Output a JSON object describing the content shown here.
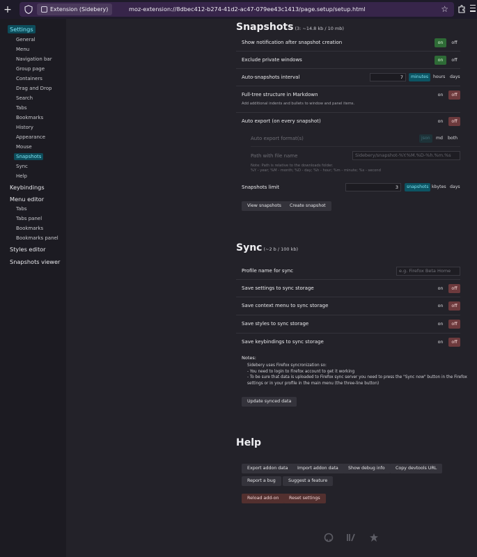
{
  "browser": {
    "extension_chip": "Extension (Sidebery)",
    "url": "moz-extension://8dbec412-b274-41d2-ac47-079ee43c1413/page.setup/setup.html"
  },
  "sidebar": {
    "items": [
      {
        "label": "Settings",
        "level": "top",
        "active": true
      },
      {
        "label": "General",
        "level": "sub"
      },
      {
        "label": "Menu",
        "level": "sub"
      },
      {
        "label": "Navigation bar",
        "level": "sub"
      },
      {
        "label": "Group page",
        "level": "sub"
      },
      {
        "label": "Containers",
        "level": "sub"
      },
      {
        "label": "Drag and Drop",
        "level": "sub"
      },
      {
        "label": "Search",
        "level": "sub"
      },
      {
        "label": "Tabs",
        "level": "sub"
      },
      {
        "label": "Bookmarks",
        "level": "sub"
      },
      {
        "label": "History",
        "level": "sub"
      },
      {
        "label": "Appearance",
        "level": "sub"
      },
      {
        "label": "Mouse",
        "level": "sub"
      },
      {
        "label": "Snapshots",
        "level": "sub",
        "active": true
      },
      {
        "label": "Sync",
        "level": "sub"
      },
      {
        "label": "Help",
        "level": "sub"
      },
      {
        "label": "Keybindings",
        "level": "top"
      },
      {
        "label": "Menu editor",
        "level": "top"
      },
      {
        "label": "Tabs",
        "level": "sub"
      },
      {
        "label": "Tabs panel",
        "level": "sub"
      },
      {
        "label": "Bookmarks",
        "level": "sub"
      },
      {
        "label": "Bookmarks panel",
        "level": "sub"
      },
      {
        "label": "Styles editor",
        "level": "top"
      },
      {
        "label": "Snapshots viewer",
        "level": "top"
      }
    ]
  },
  "snapshots": {
    "title": "Snapshots",
    "size_note": "(3: ~14.8 kb / 10 mb)",
    "show_notification": "Show notification after snapshot creation",
    "exclude_private": "Exclude private windows",
    "auto_interval": "Auto-snapshots interval",
    "auto_interval_value": "7",
    "unit_minutes": "minutes",
    "unit_hours": "hours",
    "unit_days": "days",
    "full_tree": "Full-tree structure in Markdown",
    "full_tree_note": "Add additional indents and bullets to window and panel items.",
    "auto_export": "Auto export (on every snapshot)",
    "export_format": "Auto export format(s)",
    "fmt_json": "json",
    "fmt_md": "md",
    "fmt_both": "both",
    "path_label": "Path with file name",
    "path_value": "Sidebery/snapshot-%Y.%M.%D-%h.%m.%s",
    "path_note_1": "Note: Path is relative to the downloads folder.",
    "path_note_2": "%Y - year; %M - month; %D - day; %h - hour; %m - minute; %s - second",
    "limit": "Snapshots limit",
    "limit_value": "3",
    "unit_snapshots": "snapshots",
    "unit_kbytes": "kbytes",
    "view_btn": "View snapshots",
    "create_btn": "Create snapshot"
  },
  "sync": {
    "title": "Sync",
    "size_note": "(~2 b / 100 kb)",
    "profile_name": "Profile name for sync",
    "profile_placeholder": "e.g. Firefox Beta Home",
    "save_settings": "Save settings to sync storage",
    "save_context": "Save context menu to sync storage",
    "save_styles": "Save styles to sync storage",
    "save_keybindings": "Save keybindings to sync storage",
    "notes_title": "Notes:",
    "note_1": "Sidebery uses Firefox syncronization so:",
    "note_2": "- You need to login to Firefox account to get it working",
    "note_3": "- To be sure that data is uploaded to Firefox sync server you need to press the \"Sync now\" button in the Firefox",
    "note_4": "settings or in your profile in the main menu (the three-line button)",
    "update_btn": "Update synced data"
  },
  "help": {
    "title": "Help",
    "export_btn": "Export addon data",
    "import_btn": "Import addon data",
    "debug_btn": "Show debug info",
    "devtools_btn": "Copy devtools URL",
    "bug_btn": "Report a bug",
    "feature_btn": "Suggest a feature",
    "reload_btn": "Reload add-on",
    "reset_btn": "Reset settings"
  },
  "toggle_labels": {
    "on": "on",
    "off": "off"
  },
  "colors": {
    "accent": "#0c5463",
    "on": "#2e6b36",
    "off": "#6d3a3d",
    "danger": "#53302f"
  }
}
